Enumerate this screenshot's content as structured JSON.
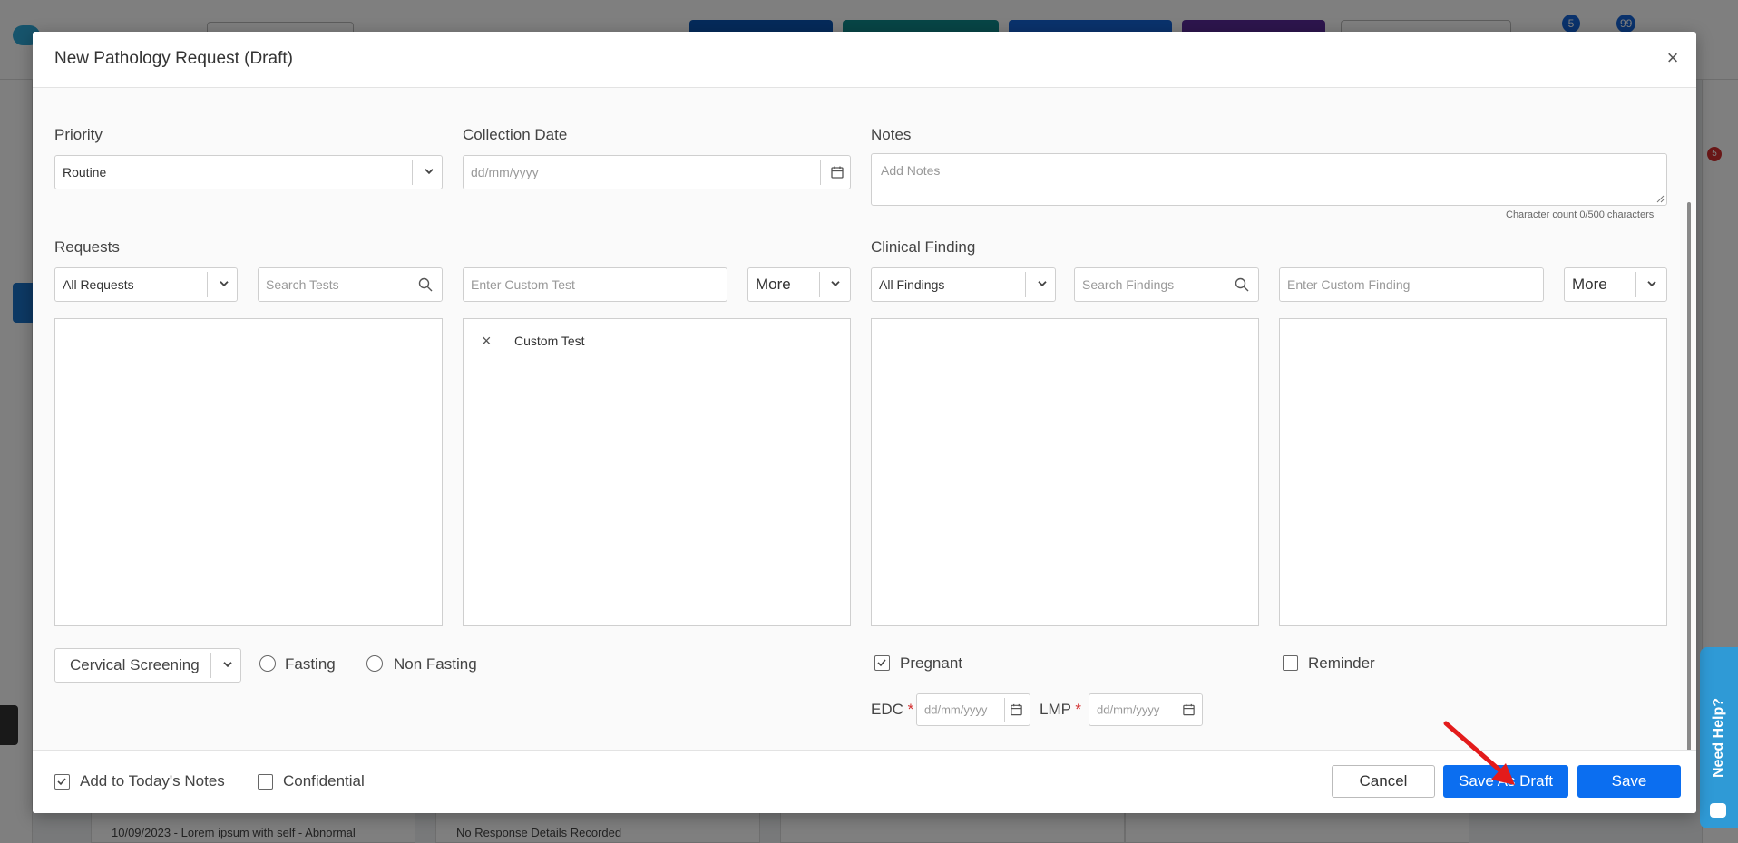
{
  "background": {
    "header_badges": [
      "5",
      "99"
    ],
    "right_badge": "5",
    "cards": [
      "10/09/2023 - Lorem ipsum with self - Abnormal",
      "No Response Details Recorded"
    ]
  },
  "need_help": {
    "label": "Need Help?"
  },
  "modal": {
    "title": "New Pathology Request (Draft)",
    "close_glyph": "×",
    "priority": {
      "label": "Priority",
      "value": "Routine"
    },
    "collection_date": {
      "label": "Collection Date",
      "placeholder": "dd/mm/yyyy"
    },
    "notes": {
      "label": "Notes",
      "placeholder": "Add Notes",
      "char_count": "Character count 0/500 characters"
    },
    "requests": {
      "label": "Requests",
      "filter_value": "All Requests",
      "search_placeholder": "Search Tests",
      "custom_placeholder": "Enter Custom Test",
      "more_label": "More",
      "selected_items": [
        {
          "remove_glyph": "×",
          "label": "Custom Test"
        }
      ]
    },
    "clinical_finding": {
      "label": "Clinical Finding",
      "filter_value": "All Findings",
      "search_placeholder": "Search Findings",
      "custom_placeholder": "Enter Custom Finding",
      "more_label": "More"
    },
    "screening": {
      "value": "Cervical Screening"
    },
    "fasting": {
      "label": "Fasting",
      "checked": false
    },
    "non_fasting": {
      "label": "Non Fasting",
      "checked": false
    },
    "pregnant": {
      "label": "Pregnant",
      "checked": true
    },
    "reminder": {
      "label": "Reminder",
      "checked": false
    },
    "edc": {
      "label": "EDC",
      "required_mark": "*",
      "placeholder": "dd/mm/yyyy"
    },
    "lmp": {
      "label": "LMP",
      "required_mark": "*",
      "placeholder": "dd/mm/yyyy"
    },
    "footer": {
      "add_to_notes": {
        "label": "Add to Today's Notes",
        "checked": true
      },
      "confidential": {
        "label": "Confidential",
        "checked": false
      },
      "cancel_label": "Cancel",
      "save_draft_label": "Save As Draft",
      "save_label": "Save"
    }
  },
  "colors": {
    "primary": "#0b6ef0",
    "arrow": "#e31b1b",
    "need_help": "#2f9ad6"
  }
}
